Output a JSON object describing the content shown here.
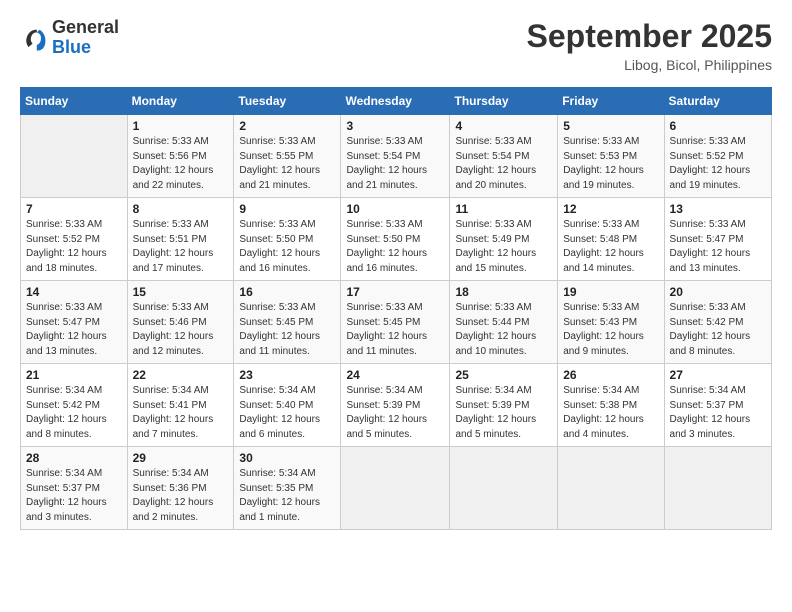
{
  "logo": {
    "general": "General",
    "blue": "Blue"
  },
  "header": {
    "month": "September 2025",
    "location": "Libog, Bicol, Philippines"
  },
  "weekdays": [
    "Sunday",
    "Monday",
    "Tuesday",
    "Wednesday",
    "Thursday",
    "Friday",
    "Saturday"
  ],
  "weeks": [
    [
      {
        "day": "",
        "info": ""
      },
      {
        "day": "1",
        "info": "Sunrise: 5:33 AM\nSunset: 5:56 PM\nDaylight: 12 hours\nand 22 minutes."
      },
      {
        "day": "2",
        "info": "Sunrise: 5:33 AM\nSunset: 5:55 PM\nDaylight: 12 hours\nand 21 minutes."
      },
      {
        "day": "3",
        "info": "Sunrise: 5:33 AM\nSunset: 5:54 PM\nDaylight: 12 hours\nand 21 minutes."
      },
      {
        "day": "4",
        "info": "Sunrise: 5:33 AM\nSunset: 5:54 PM\nDaylight: 12 hours\nand 20 minutes."
      },
      {
        "day": "5",
        "info": "Sunrise: 5:33 AM\nSunset: 5:53 PM\nDaylight: 12 hours\nand 19 minutes."
      },
      {
        "day": "6",
        "info": "Sunrise: 5:33 AM\nSunset: 5:52 PM\nDaylight: 12 hours\nand 19 minutes."
      }
    ],
    [
      {
        "day": "7",
        "info": "Sunrise: 5:33 AM\nSunset: 5:52 PM\nDaylight: 12 hours\nand 18 minutes."
      },
      {
        "day": "8",
        "info": "Sunrise: 5:33 AM\nSunset: 5:51 PM\nDaylight: 12 hours\nand 17 minutes."
      },
      {
        "day": "9",
        "info": "Sunrise: 5:33 AM\nSunset: 5:50 PM\nDaylight: 12 hours\nand 16 minutes."
      },
      {
        "day": "10",
        "info": "Sunrise: 5:33 AM\nSunset: 5:50 PM\nDaylight: 12 hours\nand 16 minutes."
      },
      {
        "day": "11",
        "info": "Sunrise: 5:33 AM\nSunset: 5:49 PM\nDaylight: 12 hours\nand 15 minutes."
      },
      {
        "day": "12",
        "info": "Sunrise: 5:33 AM\nSunset: 5:48 PM\nDaylight: 12 hours\nand 14 minutes."
      },
      {
        "day": "13",
        "info": "Sunrise: 5:33 AM\nSunset: 5:47 PM\nDaylight: 12 hours\nand 13 minutes."
      }
    ],
    [
      {
        "day": "14",
        "info": "Sunrise: 5:33 AM\nSunset: 5:47 PM\nDaylight: 12 hours\nand 13 minutes."
      },
      {
        "day": "15",
        "info": "Sunrise: 5:33 AM\nSunset: 5:46 PM\nDaylight: 12 hours\nand 12 minutes."
      },
      {
        "day": "16",
        "info": "Sunrise: 5:33 AM\nSunset: 5:45 PM\nDaylight: 12 hours\nand 11 minutes."
      },
      {
        "day": "17",
        "info": "Sunrise: 5:33 AM\nSunset: 5:45 PM\nDaylight: 12 hours\nand 11 minutes."
      },
      {
        "day": "18",
        "info": "Sunrise: 5:33 AM\nSunset: 5:44 PM\nDaylight: 12 hours\nand 10 minutes."
      },
      {
        "day": "19",
        "info": "Sunrise: 5:33 AM\nSunset: 5:43 PM\nDaylight: 12 hours\nand 9 minutes."
      },
      {
        "day": "20",
        "info": "Sunrise: 5:33 AM\nSunset: 5:42 PM\nDaylight: 12 hours\nand 8 minutes."
      }
    ],
    [
      {
        "day": "21",
        "info": "Sunrise: 5:34 AM\nSunset: 5:42 PM\nDaylight: 12 hours\nand 8 minutes."
      },
      {
        "day": "22",
        "info": "Sunrise: 5:34 AM\nSunset: 5:41 PM\nDaylight: 12 hours\nand 7 minutes."
      },
      {
        "day": "23",
        "info": "Sunrise: 5:34 AM\nSunset: 5:40 PM\nDaylight: 12 hours\nand 6 minutes."
      },
      {
        "day": "24",
        "info": "Sunrise: 5:34 AM\nSunset: 5:39 PM\nDaylight: 12 hours\nand 5 minutes."
      },
      {
        "day": "25",
        "info": "Sunrise: 5:34 AM\nSunset: 5:39 PM\nDaylight: 12 hours\nand 5 minutes."
      },
      {
        "day": "26",
        "info": "Sunrise: 5:34 AM\nSunset: 5:38 PM\nDaylight: 12 hours\nand 4 minutes."
      },
      {
        "day": "27",
        "info": "Sunrise: 5:34 AM\nSunset: 5:37 PM\nDaylight: 12 hours\nand 3 minutes."
      }
    ],
    [
      {
        "day": "28",
        "info": "Sunrise: 5:34 AM\nSunset: 5:37 PM\nDaylight: 12 hours\nand 3 minutes."
      },
      {
        "day": "29",
        "info": "Sunrise: 5:34 AM\nSunset: 5:36 PM\nDaylight: 12 hours\nand 2 minutes."
      },
      {
        "day": "30",
        "info": "Sunrise: 5:34 AM\nSunset: 5:35 PM\nDaylight: 12 hours\nand 1 minute."
      },
      {
        "day": "",
        "info": ""
      },
      {
        "day": "",
        "info": ""
      },
      {
        "day": "",
        "info": ""
      },
      {
        "day": "",
        "info": ""
      }
    ]
  ]
}
